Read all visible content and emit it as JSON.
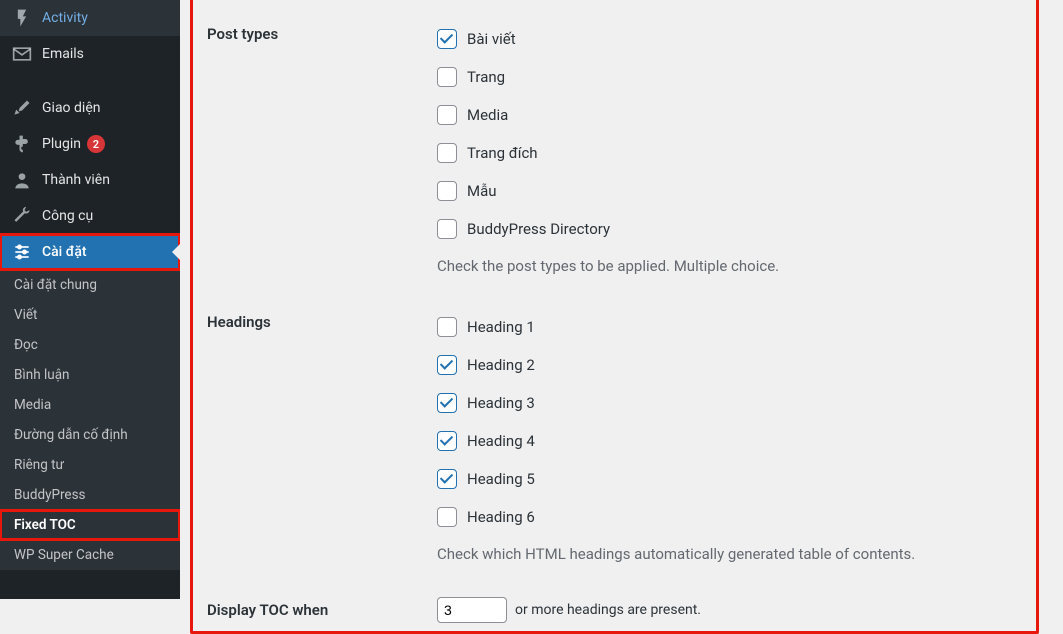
{
  "sidebar": {
    "top_items": [
      {
        "label": "Activity",
        "icon": "activity"
      },
      {
        "label": "Emails",
        "icon": "email"
      }
    ],
    "mid_items": [
      {
        "label": "Giao diện",
        "icon": "appearance"
      },
      {
        "label": "Plugin",
        "icon": "plugin",
        "badge": "2"
      },
      {
        "label": "Thành viên",
        "icon": "users"
      },
      {
        "label": "Công cụ",
        "icon": "tools"
      },
      {
        "label": "Cài đặt",
        "icon": "settings",
        "current": true
      }
    ],
    "submenu": [
      "Cài đặt chung",
      "Viết",
      "Đọc",
      "Bình luận",
      "Media",
      "Đường dẫn cố định",
      "Riêng tư",
      "BuddyPress",
      "Fixed TOC",
      "WP Super Cache"
    ],
    "submenu_active": "Fixed TOC"
  },
  "settings": {
    "post_types": {
      "label": "Post types",
      "options": [
        {
          "label": "Bài viết",
          "checked": true
        },
        {
          "label": "Trang",
          "checked": false
        },
        {
          "label": "Media",
          "checked": false
        },
        {
          "label": "Trang đích",
          "checked": false
        },
        {
          "label": "Mẫu",
          "checked": false
        },
        {
          "label": "BuddyPress Directory",
          "checked": false
        }
      ],
      "description": "Check the post types to be applied. Multiple choice."
    },
    "headings": {
      "label": "Headings",
      "options": [
        {
          "label": "Heading 1",
          "checked": false
        },
        {
          "label": "Heading 2",
          "checked": true
        },
        {
          "label": "Heading 3",
          "checked": true
        },
        {
          "label": "Heading 4",
          "checked": true
        },
        {
          "label": "Heading 5",
          "checked": true
        },
        {
          "label": "Heading 6",
          "checked": false
        }
      ],
      "description": "Check which HTML headings automatically generated table of contents."
    },
    "display_when": {
      "label": "Display TOC when",
      "value": "3",
      "suffix": "or more headings are present."
    }
  }
}
